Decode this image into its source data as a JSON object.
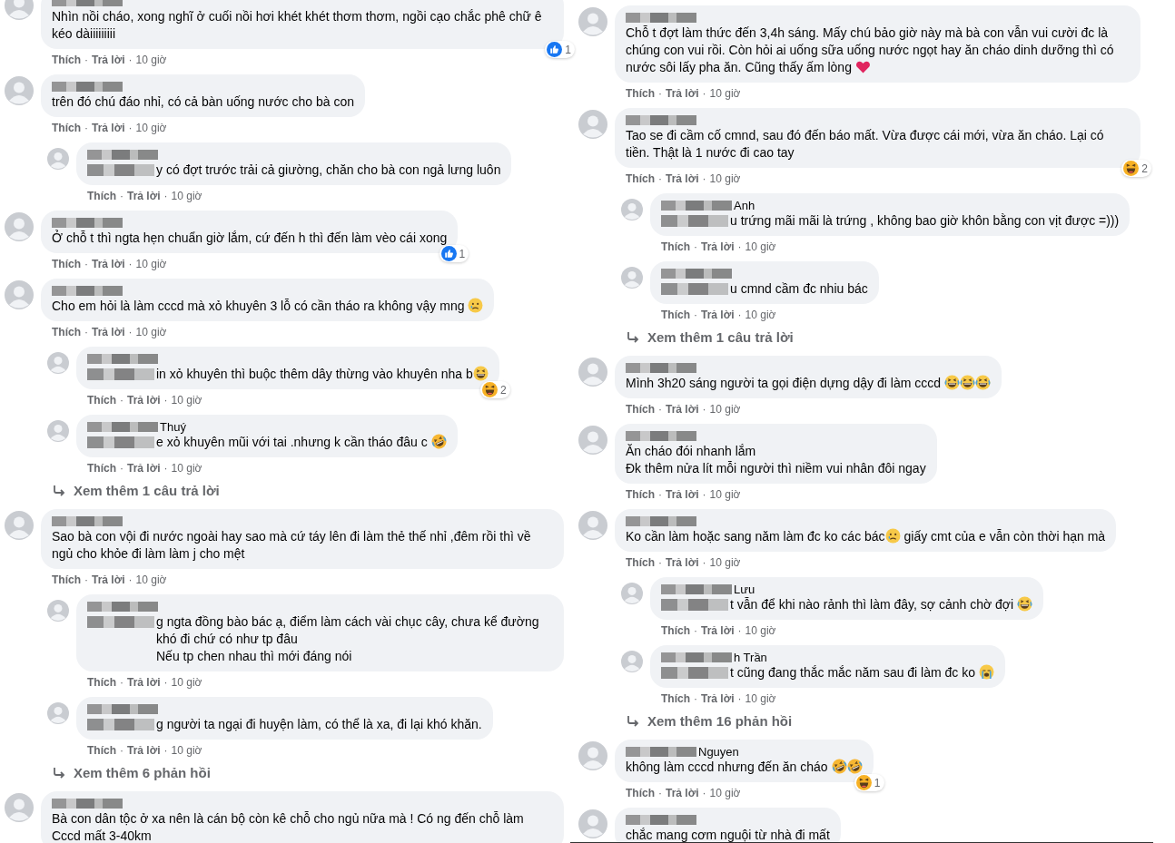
{
  "columns": [
    {
      "comments": [
        {
          "tagged": false,
          "body": [
            {
              "kind": "text",
              "text": "Nhìn nồi cháo, xong nghĩ ở cuối nồi hơi khét khét thơm thơm, ngồi cạo chắc phê chữ ê kéo dàiiiiiiiii"
            }
          ],
          "meta": [
            "Thích",
            "·",
            "Trả lời",
            "·",
            "10 giờ"
          ],
          "reaction": {
            "kind": "like",
            "count": "1"
          }
        },
        {
          "tagged": false,
          "body": [
            {
              "kind": "text",
              "text": "trên đó chú đáo nhỉ, có cả bàn uống nước cho bà con"
            }
          ],
          "meta": [
            "Thích",
            "·",
            "Trả lời",
            "·",
            "10 giờ"
          ],
          "children": [
            {
              "tagged": true,
              "body": [
                {
                  "kind": "text",
                  "text": "y có đợt trước trải cả giường, chăn cho bà con ngả lưng luôn"
                }
              ],
              "meta": [
                "Thích",
                "·",
                "Trả lời",
                "·",
                "10 giờ"
              ]
            }
          ]
        },
        {
          "tagged": false,
          "body": [
            {
              "kind": "text",
              "text": "Ở chỗ t thì ngta hẹn chuẩn giờ lắm, cứ đến h thì đến làm vèo cái xong"
            }
          ],
          "meta": [
            "Thích",
            "·",
            "Trả lời",
            "·",
            "10 giờ"
          ],
          "reaction": {
            "kind": "like",
            "count": "1"
          }
        },
        {
          "tagged": false,
          "body": [
            {
              "kind": "text",
              "text": "Cho em hỏi là làm cccd mà xỏ khuyên 3 lỗ có cần tháo ra không vậy mng "
            },
            {
              "kind": "sad"
            }
          ],
          "meta": [
            "Thích",
            "·",
            "Trả lời",
            "·",
            "10 giờ"
          ],
          "children": [
            {
              "tagged": true,
              "body": [
                {
                  "kind": "text",
                  "text": "in xỏ khuyên thì buộc thêm dây thừng vào khuyên nha b"
                },
                {
                  "kind": "grin"
                }
              ],
              "meta": [
                "Thích",
                "·",
                "Trả lời",
                "·",
                "10 giờ"
              ],
              "reaction": {
                "kind": "haha",
                "count": "2"
              }
            },
            {
              "name": "Thuý",
              "tagged": true,
              "body": [
                {
                  "kind": "text",
                  "text": "e xỏ khuyên mũi với tai .nhưng k cần tháo đâu c "
                },
                {
                  "kind": "rofl"
                }
              ],
              "meta": [
                "Thích",
                "·",
                "Trả lời",
                "·",
                "10 giờ"
              ]
            }
          ],
          "more": "Xem thêm 1 câu trả lời"
        },
        {
          "tagged": false,
          "body": [
            {
              "kind": "text",
              "text": "Sao bà con vội đi nước ngoài hay sao mà cứ táy lên đi làm thẻ thế nhỉ ,đêm rồi thì về ngủ cho khỏe đi làm làm j cho mệt"
            }
          ],
          "meta": [
            "Thích",
            "·",
            "Trả lời",
            "·",
            "10 giờ"
          ],
          "children": [
            {
              "tagged": true,
              "body": [
                {
                  "kind": "text",
                  "text": "g ngta đồng bào bác ạ, điểm làm cách vài chục cây, chưa kể đường khó đi chứ có như tp đâu\nNếu tp chen nhau thì mới đáng nói"
                }
              ],
              "meta": [
                "Thích",
                "·",
                "Trả lời",
                "·",
                "10 giờ"
              ]
            },
            {
              "tagged": true,
              "body": [
                {
                  "kind": "text",
                  "text": "g người ta ngại đi huyện làm, có thể là xa, đi lại khó khăn."
                }
              ],
              "meta": [
                "Thích",
                "·",
                "Trả lời",
                "·",
                "10 giờ"
              ]
            }
          ],
          "more": "Xem thêm 6 phản hồi"
        },
        {
          "tagged": false,
          "body": [
            {
              "kind": "text",
              "text": "Bà con dân tộc ở xa nên là cán bộ còn kê chỗ cho ngủ nữa mà ! Có ng đến chỗ làm Cccd mất 3-40km"
            }
          ]
        }
      ]
    },
    {
      "comments": [
        {
          "tagged": false,
          "body": [
            {
              "kind": "text",
              "text": "Chỗ t đợt làm thức đến 3,4h sáng. Mấy chú bảo giờ này mà bà con vẫn vui cười đc là chúng con vui rồi. Còn hỏi ai uống sữa uống nước ngọt hay ăn cháo dinh dưỡng thì có nước sôi lấy pha ăn. Cũng thấy ấm lòng "
            },
            {
              "kind": "heart"
            }
          ],
          "meta": [
            "Thích",
            "·",
            "Trả lời",
            "·",
            "10 giờ"
          ]
        },
        {
          "tagged": false,
          "body": [
            {
              "kind": "text",
              "text": "Tao se đi cầm cố cmnd, sau đó đến báo mất. Vừa được cái mới, vừa ăn cháo. Lại có tiền. Thật là 1 nước đi cao tay"
            }
          ],
          "meta": [
            "Thích",
            "·",
            "Trả lời",
            "·",
            "10 giờ"
          ],
          "reaction": {
            "kind": "haha",
            "count": "2"
          },
          "children": [
            {
              "name": "Anh",
              "tagged": true,
              "body": [
                {
                  "kind": "text",
                  "text": "u trứng mãi mãi là trứng , không bao giờ khôn bằng con vịt được =)))"
                }
              ],
              "meta": [
                "Thích",
                "·",
                "Trả lời",
                "·",
                "10 giờ"
              ]
            },
            {
              "tagged": true,
              "body": [
                {
                  "kind": "text",
                  "text": "u cmnd cầm đc nhiu bác"
                }
              ],
              "meta": [
                "Thích",
                "·",
                "Trả lời",
                "·",
                "10 giờ"
              ]
            }
          ],
          "more": "Xem thêm 1 câu trả lời"
        },
        {
          "tagged": false,
          "body": [
            {
              "kind": "text",
              "text": "Mình 3h20 sáng người ta gọi điện dựng dậy đi làm cccd "
            },
            {
              "kind": "joy"
            },
            {
              "kind": "joy"
            },
            {
              "kind": "joy"
            }
          ],
          "meta": [
            "Thích",
            "·",
            "Trả lời",
            "·",
            "10 giờ"
          ]
        },
        {
          "tagged": false,
          "body": [
            {
              "kind": "text",
              "text": "Ăn cháo đói nhanh lắm\nĐk thêm nửa lít mỗi người thì niềm vui nhân đôi ngay"
            }
          ],
          "meta": [
            "Thích",
            "·",
            "Trả lời",
            "·",
            "10 giờ"
          ]
        },
        {
          "tagged": false,
          "body": [
            {
              "kind": "text",
              "text": "Ko cần làm hoặc sang năm làm đc ko các bác"
            },
            {
              "kind": "sad"
            },
            {
              "kind": "text",
              "text": " giấy cmt của e vẫn còn thời hạn mà"
            }
          ],
          "meta": [
            "Thích",
            "·",
            "Trả lời",
            "·",
            "10 giờ"
          ],
          "children": [
            {
              "name": "Lưu",
              "tagged": true,
              "body": [
                {
                  "kind": "text",
                  "text": "t vẫn để khi nào rảnh thì làm đây, sợ cảnh chờ đợi "
                },
                {
                  "kind": "joy"
                }
              ],
              "meta": [
                "Thích",
                "·",
                "Trả lời",
                "·",
                "10 giờ"
              ]
            },
            {
              "name": "h Trần",
              "tagged": true,
              "body": [
                {
                  "kind": "text",
                  "text": "t cũng đang thắc mắc năm sau đi làm đc ko "
                },
                {
                  "kind": "sob"
                }
              ],
              "meta": [
                "Thích",
                "·",
                "Trả lời",
                "·",
                "10 giờ"
              ]
            }
          ],
          "more": "Xem thêm 16 phản hồi"
        },
        {
          "name": "Nguyen",
          "tagged": false,
          "body": [
            {
              "kind": "text",
              "text": "không làm cccd nhưng đến ăn cháo "
            },
            {
              "kind": "rofl"
            },
            {
              "kind": "rofl"
            }
          ],
          "meta": [
            "Thích",
            "·",
            "Trả lời",
            "·",
            "10 giờ"
          ],
          "reaction": {
            "kind": "haha",
            "count": "1"
          }
        },
        {
          "tagged": false,
          "body": [
            {
              "kind": "text",
              "text": "chắc mang cơm nguội từ nhà đi mất"
            }
          ]
        }
      ]
    }
  ]
}
